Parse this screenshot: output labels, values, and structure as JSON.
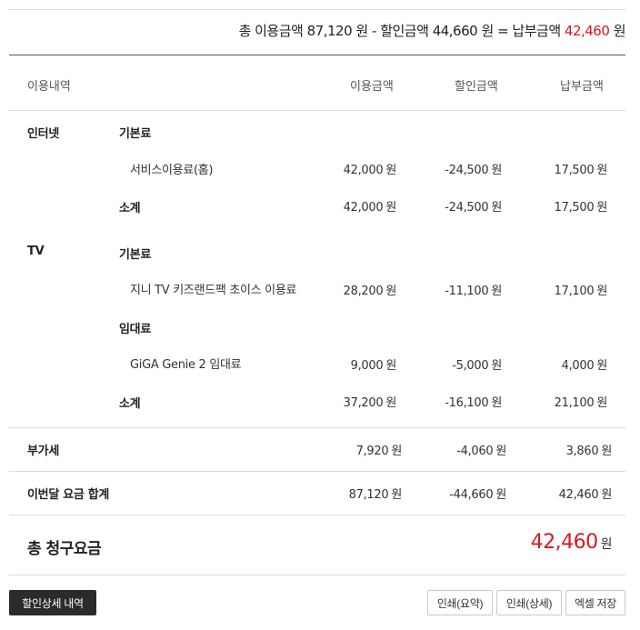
{
  "summary": {
    "total_label": "총 이용금액",
    "total_value": "87,120",
    "unit": "원",
    "minus": "-",
    "discount_label": "할인금액",
    "discount_value": "44,660",
    "equals": "=",
    "pay_label": "납부금액",
    "pay_value": "42,460",
    "accent_color": "#d71920"
  },
  "table": {
    "headers": [
      "이용내역",
      "이용금액",
      "할인금액",
      "납부금액"
    ],
    "unit": "원"
  },
  "internet": {
    "category": "인터넷",
    "group_basic": "기본료",
    "item1": {
      "name": "서비스이용료(홈)",
      "use": "42,000",
      "discount": "-24,500",
      "pay": "17,500"
    },
    "subtotal": {
      "label": "소계",
      "use": "42,000",
      "discount": "-24,500",
      "pay": "17,500"
    }
  },
  "tv": {
    "category": "TV",
    "group_basic": "기본료",
    "item1": {
      "name": "지니 TV 키즈랜드팩 초이스 이용료",
      "use": "28,200",
      "discount": "-11,100",
      "pay": "17,100"
    },
    "group_rent": "임대료",
    "item2": {
      "name": "GiGA Genie 2 임대료",
      "use": "9,000",
      "discount": "-5,000",
      "pay": "4,000"
    },
    "subtotal": {
      "label": "소계",
      "use": "37,200",
      "discount": "-16,100",
      "pay": "21,100"
    }
  },
  "vat": {
    "label": "부가세",
    "use": "7,920",
    "discount": "-4,060",
    "pay": "3,860"
  },
  "month_total": {
    "label": "이번달 요금 합계",
    "use": "87,120",
    "discount": "-44,660",
    "pay": "42,460"
  },
  "grand_total": {
    "label": "총 청구요금",
    "value": "42,460",
    "unit": "원"
  },
  "buttons": {
    "discount_detail": "할인상세 내역",
    "print_summary": "인쇄(요약)",
    "print_detail": "인쇄(상세)",
    "excel_save": "엑셀 저장"
  }
}
